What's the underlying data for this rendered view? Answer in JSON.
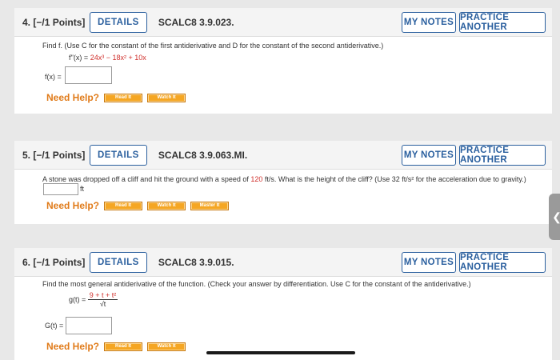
{
  "questions": [
    {
      "number": "4.",
      "points": "[−/1 Points]",
      "details_label": "DETAILS",
      "code": "SCALC8 3.9.023.",
      "my_notes_label": "MY NOTES",
      "practice_label": "PRACTICE ANOTHER",
      "prompt": "Find f. (Use C for the constant of the first antiderivative and D for the constant of the second antiderivative.)",
      "equation_lhs": "f''(x) =",
      "equation_rhs": "24x³ − 18x² + 10x",
      "answer_label": "f(x) =",
      "answer_value": "",
      "need_help": "Need Help?",
      "help_buttons": [
        "Read It",
        "Watch It"
      ]
    },
    {
      "number": "5.",
      "points": "[−/1 Points]",
      "details_label": "DETAILS",
      "code": "SCALC8 3.9.063.MI.",
      "my_notes_label": "MY NOTES",
      "practice_label": "PRACTICE ANOTHER",
      "prompt_before": "A stone was dropped off a cliff and hit the ground with a speed of ",
      "prompt_red": "120",
      "prompt_after": " ft/s. What is the height of the cliff? (Use 32 ft/s² for the acceleration due to gravity.)",
      "answer_value": "",
      "answer_unit": "ft",
      "need_help": "Need Help?",
      "help_buttons": [
        "Read It",
        "Watch It",
        "Master It"
      ]
    },
    {
      "number": "6.",
      "points": "[−/1 Points]",
      "details_label": "DETAILS",
      "code": "SCALC8 3.9.015.",
      "my_notes_label": "MY NOTES",
      "practice_label": "PRACTICE ANOTHER",
      "prompt": "Find the most general antiderivative of the function. (Check your answer by differentiation. Use C for the constant of the antiderivative.)",
      "equation_lhs": "g(t) =",
      "frac_num": "9 + t + t²",
      "frac_den": "√t",
      "answer_label": "G(t) =",
      "answer_value": "",
      "need_help": "Need Help?",
      "help_buttons": [
        "Read It",
        "Watch It"
      ]
    }
  ],
  "side_tab_glyph": "❮"
}
